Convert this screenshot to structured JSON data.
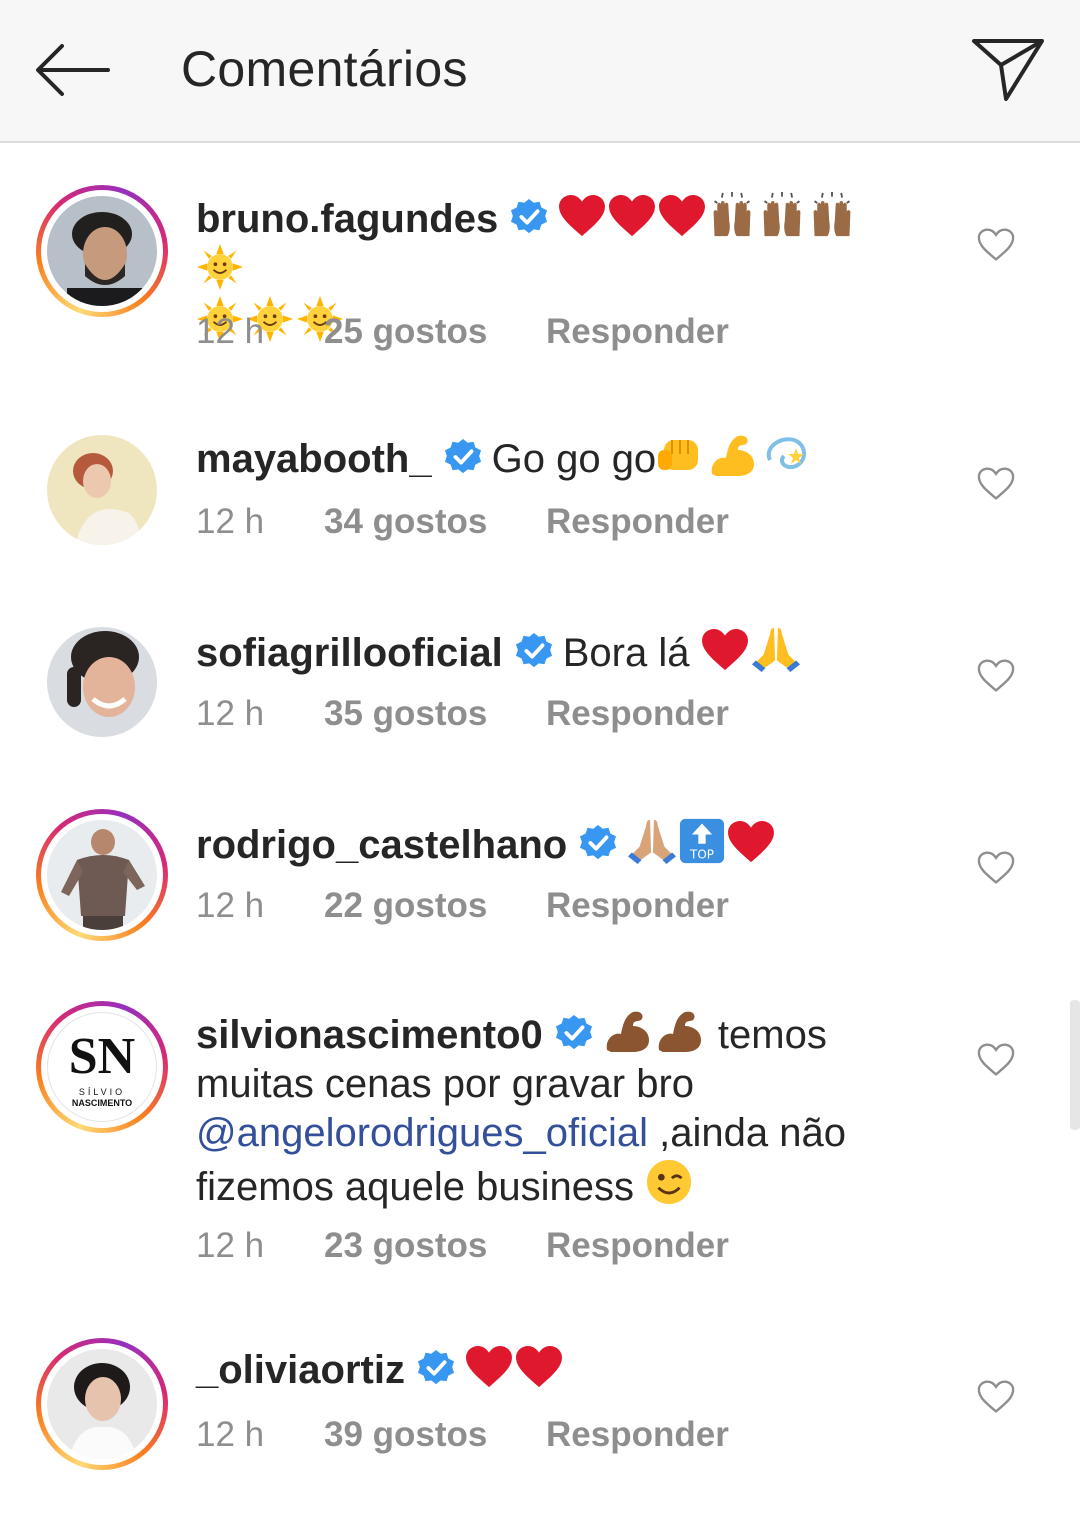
{
  "header": {
    "title": "Comentários",
    "back_icon": "arrow-left-icon",
    "send_icon": "paper-plane-icon"
  },
  "comments": [
    {
      "username": "bruno.fagundes",
      "verified": true,
      "text": "",
      "emojis": [
        "heart",
        "heart",
        "heart",
        "raised-hands",
        "raised-hands",
        "raised-hands",
        "sun",
        "sun",
        "sun",
        "sun"
      ],
      "time": "12 h",
      "likes": "25 gostos",
      "reply": "Responder",
      "story_ring": true
    },
    {
      "username": "mayabooth_",
      "verified": true,
      "text": "Go go go",
      "emojis": [
        "fist",
        "flexed-biceps",
        "dizzy"
      ],
      "time": "12 h",
      "likes": "34 gostos",
      "reply": "Responder",
      "story_ring": false
    },
    {
      "username": "sofiagrillooficial",
      "verified": true,
      "text": "Bora lá",
      "emojis": [
        "heart",
        "folded-hands"
      ],
      "time": "12 h",
      "likes": "35 gostos",
      "reply": "Responder",
      "story_ring": false
    },
    {
      "username": "rodrigo_castelhano",
      "verified": true,
      "text": "",
      "emojis": [
        "folded-hands",
        "top-arrow",
        "heart"
      ],
      "time": "12 h",
      "likes": "22 gostos",
      "reply": "Responder",
      "story_ring": true
    },
    {
      "username": "silvionascimento0",
      "verified": true,
      "text_before": "temos muitas cenas por gravar bro",
      "mention": "@angelorodrigues_oficial",
      "text_after": ",ainda não fizemos aquele business",
      "emojis": [
        "flexed-biceps",
        "flexed-biceps",
        "winking-face"
      ],
      "time": "12 h",
      "likes": "23 gostos",
      "reply": "Responder",
      "story_ring": true,
      "avatar_logo_top": "SN",
      "avatar_logo_line1": "SÍLVIO",
      "avatar_logo_line2": "NASCIMENTO"
    },
    {
      "username": "_oliviaortiz",
      "verified": true,
      "text": "",
      "emojis": [
        "heart",
        "heart"
      ],
      "time": "12 h",
      "likes": "39 gostos",
      "reply": "Responder",
      "story_ring": true
    }
  ],
  "colors": {
    "verified": "#3897f0",
    "heart": "#e0182d",
    "mention": "#34509a",
    "meta": "#8e8e8e"
  }
}
